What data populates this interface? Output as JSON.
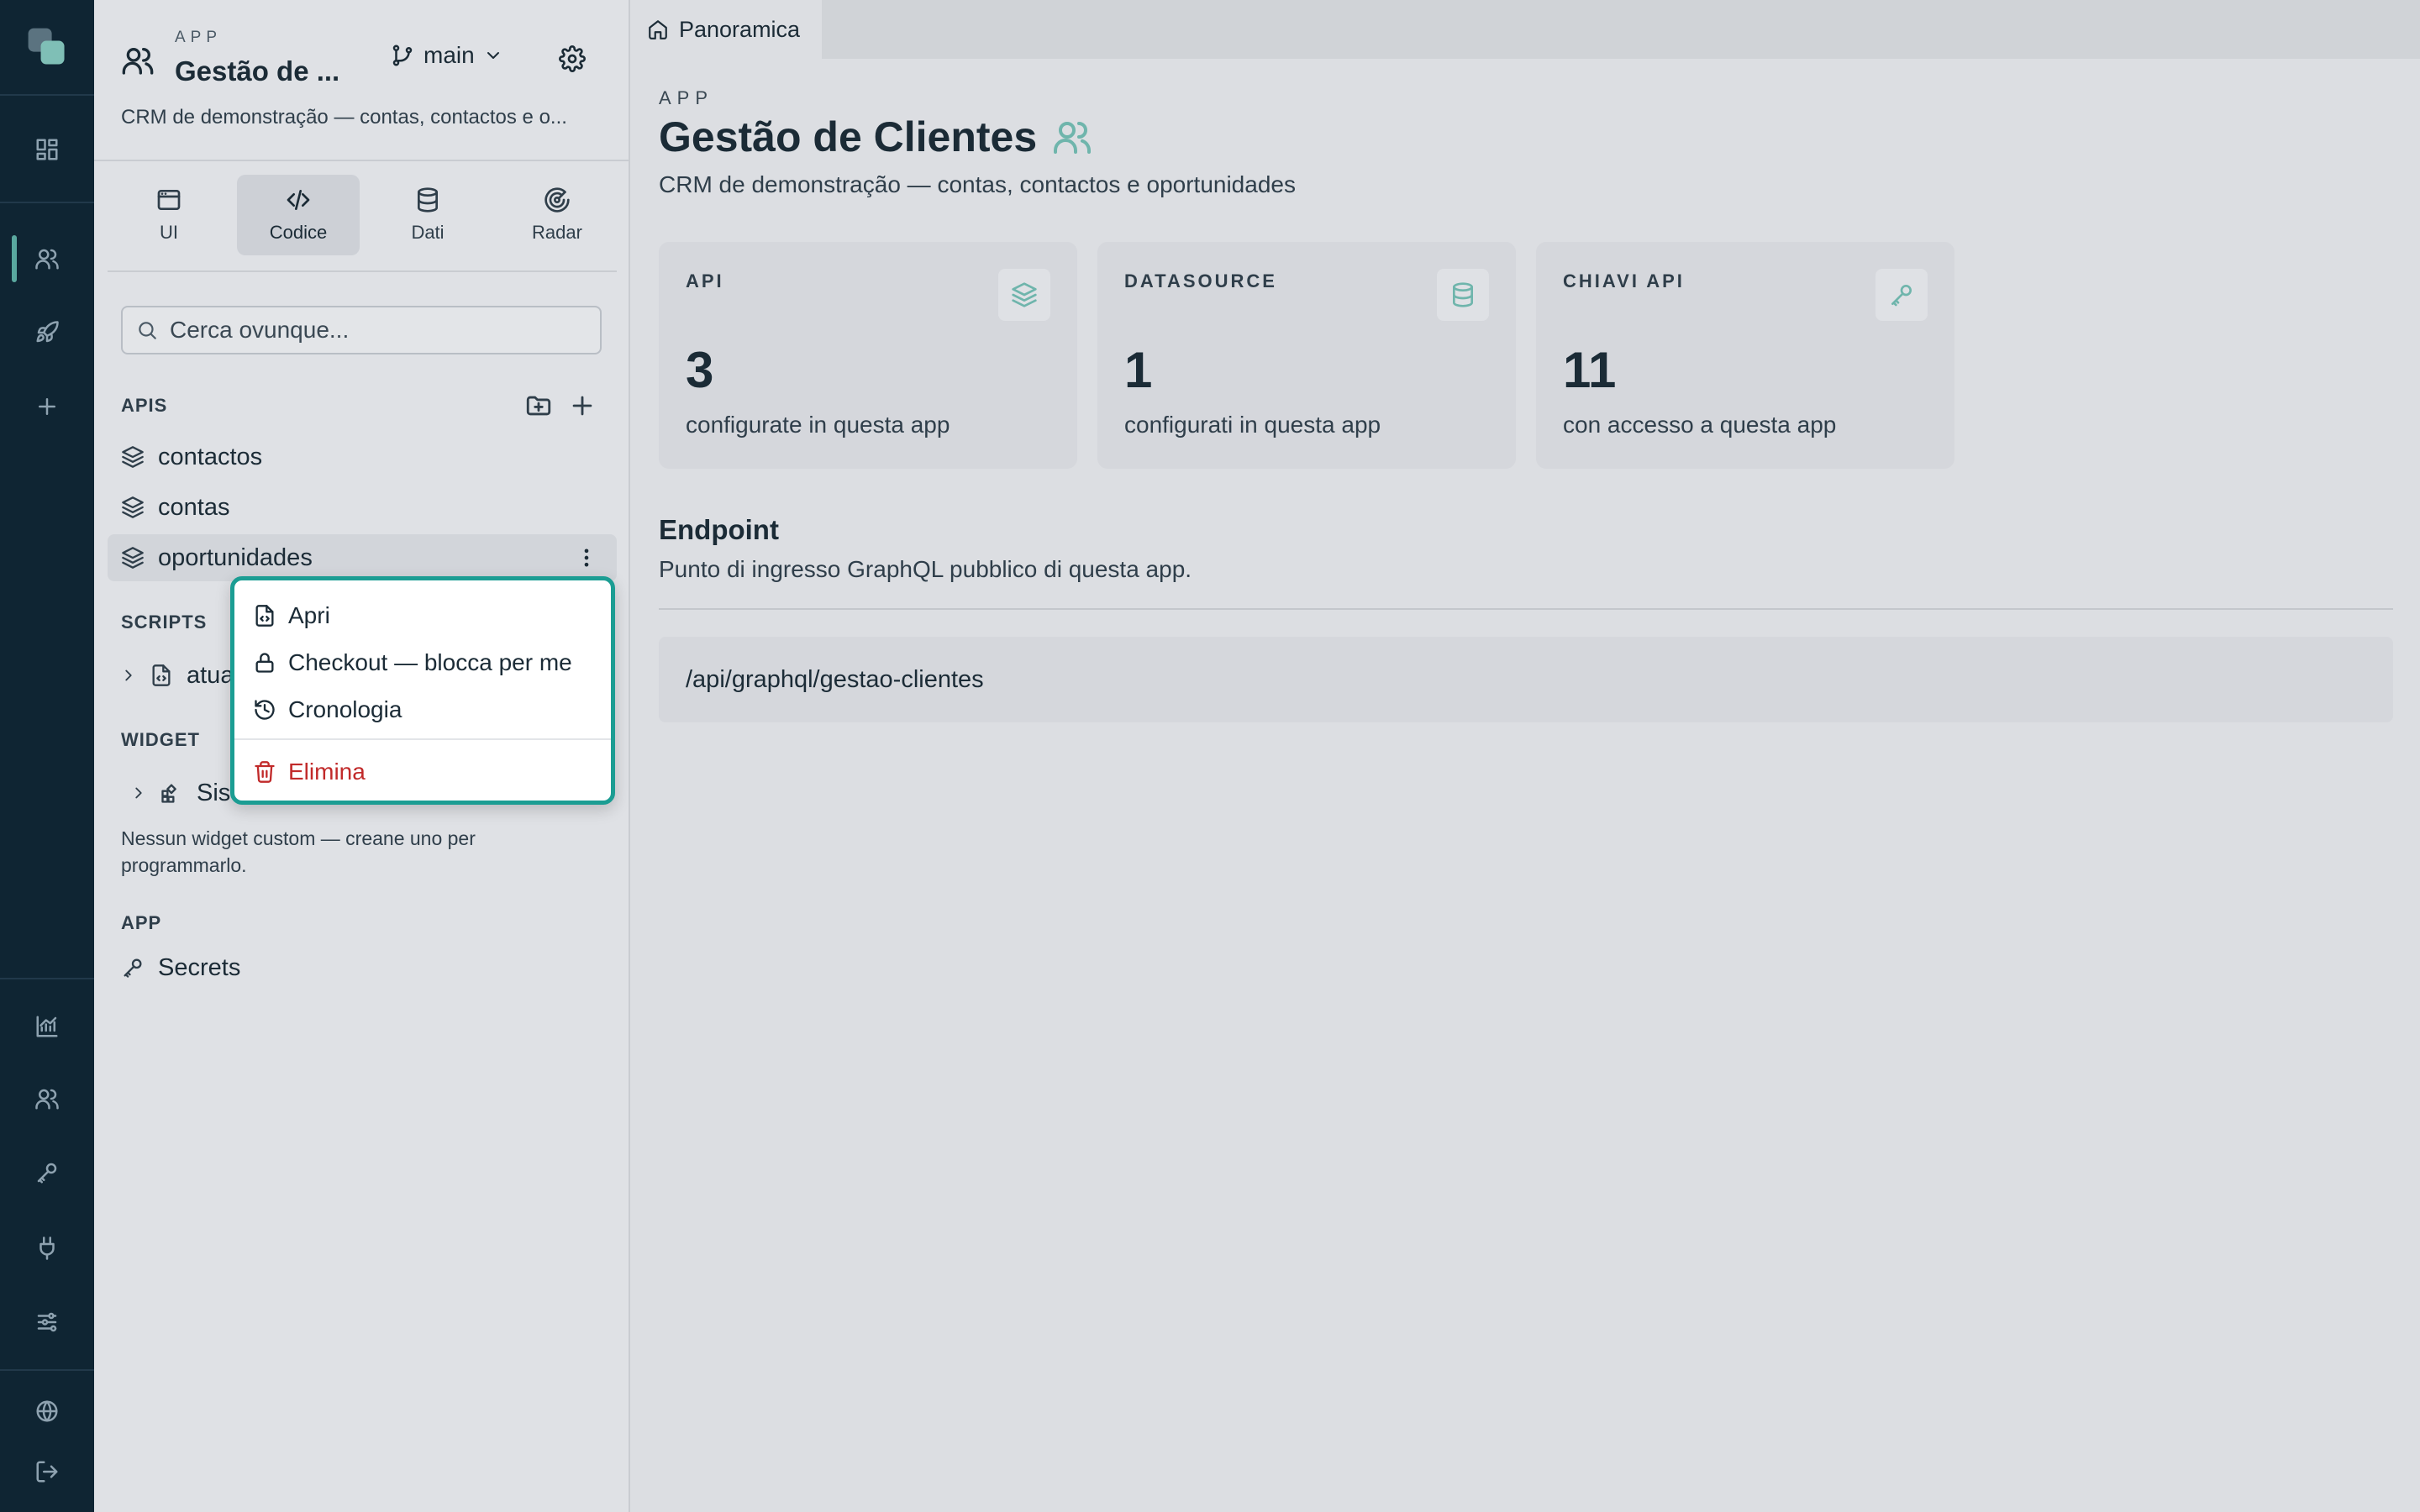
{
  "sidebar": {
    "app_tag": "APP",
    "app_name": "Gestão de ...",
    "branch": "main",
    "description": "CRM de demonstração — contas, contactos e o...",
    "tabs": [
      {
        "label": "UI",
        "icon": "browser-window-icon"
      },
      {
        "label": "Codice",
        "icon": "code-icon",
        "active": true
      },
      {
        "label": "Dati",
        "icon": "database-icon"
      },
      {
        "label": "Radar",
        "icon": "radar-icon"
      }
    ],
    "search_placeholder": "Cerca ovunque...",
    "apis_label": "APIS",
    "apis": [
      "contactos",
      "contas",
      "oportunidades"
    ],
    "scripts_label": "SCRIPTS",
    "scripts": [
      "atua"
    ],
    "widget_label": "WIDGET",
    "widgets": [
      "Sistema"
    ],
    "widget_hint": "Nessun widget custom — creane uno per programmarlo.",
    "app_label": "APP",
    "app_items": [
      "Secrets"
    ]
  },
  "context_menu": {
    "items": [
      {
        "label": "Apri",
        "icon": "file-code-icon"
      },
      {
        "label": "Checkout — blocca per me",
        "icon": "lock-icon"
      },
      {
        "label": "Cronologia",
        "icon": "history-icon"
      },
      {
        "label": "Elimina",
        "icon": "trash-icon",
        "danger": true
      }
    ]
  },
  "main": {
    "tab_label": "Panoramica",
    "app_tag": "APP",
    "title": "Gestão de Clientes",
    "subtitle": "CRM de demonstração — contas, contactos e oportunidades",
    "cards": [
      {
        "label": "API",
        "value": "3",
        "desc": "configurate in questa app",
        "icon": "layers-icon"
      },
      {
        "label": "DATASOURCE",
        "value": "1",
        "desc": "configurati in questa app",
        "icon": "database-icon"
      },
      {
        "label": "CHIAVI API",
        "value": "11",
        "desc": "con accesso a questa app",
        "icon": "key-icon"
      }
    ],
    "endpoint_title": "Endpoint",
    "endpoint_sub": "Punto di ingresso GraphQL pubblico di questa app.",
    "endpoint_path": "/api/graphql/gestao-clientes"
  },
  "colors": {
    "rail_bg": "#0f2533",
    "accent": "#1b9d93",
    "danger": "#c12a2a",
    "icon_accent": "#6fb5ac"
  }
}
